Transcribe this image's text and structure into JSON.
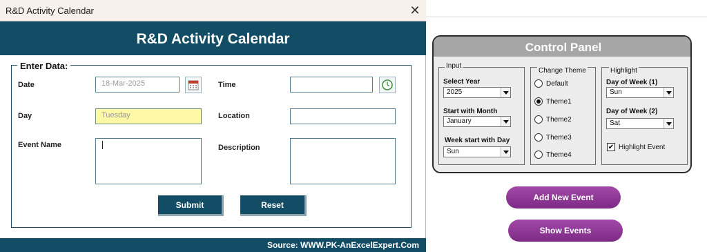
{
  "window": {
    "title": "R&D Activity Calendar",
    "close_glyph": "✕"
  },
  "header": {
    "title": "R&D Activity Calendar"
  },
  "form": {
    "legend": "Enter Data:",
    "date_label": "Date",
    "date_value": "18-Mar-2025",
    "day_label": "Day",
    "day_value": "Tuesday",
    "event_name_label": "Event Name",
    "event_name_value": "",
    "time_label": "Time",
    "time_value": "",
    "location_label": "Location",
    "location_value": "",
    "description_label": "Description",
    "description_value": "",
    "calendar_icon": "calendar-icon",
    "clock_icon": "clock-icon"
  },
  "buttons": {
    "submit": "Submit",
    "reset": "Reset"
  },
  "footer": {
    "source": "Source: WWW.PK-AnExcelExpert.Com"
  },
  "control_panel": {
    "title": "Control Panel",
    "input_group": "Input",
    "select_year_label": "Select Year",
    "select_year_value": "2025",
    "start_month_label": "Start with Month",
    "start_month_value": "January",
    "week_start_label": "Week start with Day",
    "week_start_value": "Sun",
    "theme_group": "Change Theme",
    "themes": [
      "Default",
      "Theme1",
      "Theme2",
      "Theme3",
      "Theme4"
    ],
    "selected_theme": "Theme1",
    "highlight_group": "Highlight",
    "dow1_label": "Day of Week (1)",
    "dow1_value": "Sun",
    "dow2_label": "Day of Week (2)",
    "dow2_value": "Sat",
    "highlight_event_label": "Highlight Event",
    "highlight_event_checked": true
  },
  "actions": {
    "add_new_event": "Add New Event",
    "show_events": "Show Events"
  },
  "colors": {
    "header": "#134c65",
    "accent_pill": "#8e3a97",
    "day_field": "#fdf8a5"
  }
}
